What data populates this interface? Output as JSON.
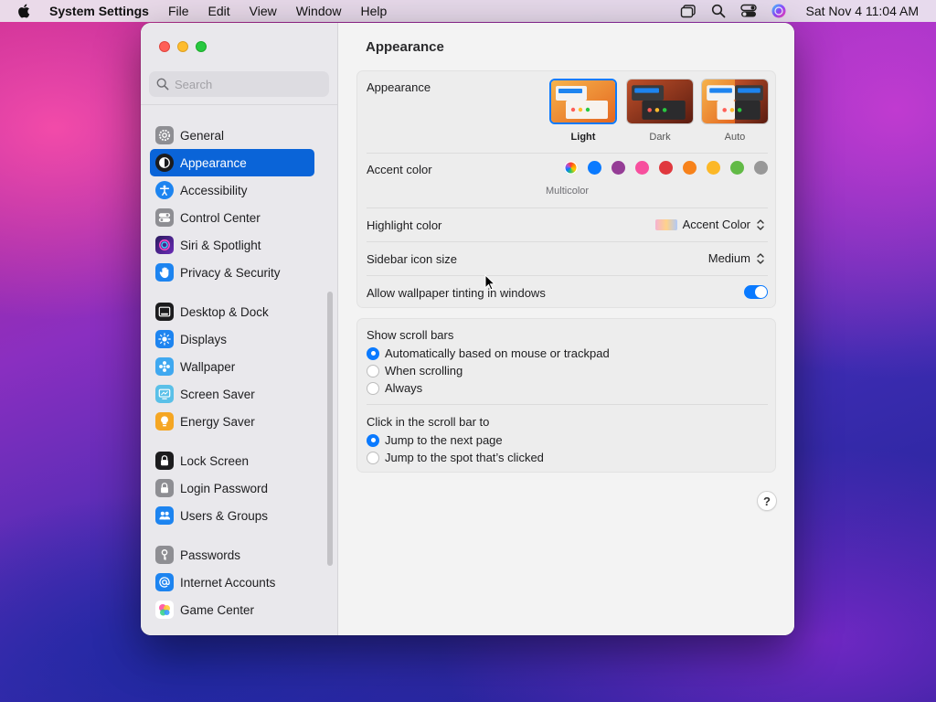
{
  "menubar": {
    "app_name": "System Settings",
    "items": [
      "File",
      "Edit",
      "View",
      "Window",
      "Help"
    ],
    "clock": "Sat Nov 4  11:04 AM"
  },
  "sidebar": {
    "search_placeholder": "Search",
    "groups": [
      [
        {
          "label": "General",
          "icon": "gear-icon",
          "color": "#8e8e93"
        },
        {
          "label": "Appearance",
          "icon": "appearance-icon",
          "color": "#1c1c1e",
          "selected": true
        },
        {
          "label": "Accessibility",
          "icon": "accessibility-icon",
          "color": "#1d84f0"
        },
        {
          "label": "Control Center",
          "icon": "control-center-icon",
          "color": "#8e8e93"
        },
        {
          "label": "Siri & Spotlight",
          "icon": "siri-icon",
          "color": "#5a2bb8"
        },
        {
          "label": "Privacy & Security",
          "icon": "hand-icon",
          "color": "#1d84f0"
        }
      ],
      [
        {
          "label": "Desktop & Dock",
          "icon": "dock-icon",
          "color": "#1c1c1e"
        },
        {
          "label": "Displays",
          "icon": "sun-icon",
          "color": "#1d84f0"
        },
        {
          "label": "Wallpaper",
          "icon": "wallpaper-icon",
          "color": "#3fa8f0"
        },
        {
          "label": "Screen Saver",
          "icon": "screen-saver-icon",
          "color": "#5ac0e8"
        },
        {
          "label": "Energy Saver",
          "icon": "bulb-icon",
          "color": "#f5a623"
        }
      ],
      [
        {
          "label": "Lock Screen",
          "icon": "lock-icon",
          "color": "#1c1c1e"
        },
        {
          "label": "Login Password",
          "icon": "padlock-icon",
          "color": "#8e8e93"
        },
        {
          "label": "Users & Groups",
          "icon": "users-icon",
          "color": "#1d84f0"
        }
      ],
      [
        {
          "label": "Passwords",
          "icon": "key-icon",
          "color": "#8e8e93"
        },
        {
          "label": "Internet Accounts",
          "icon": "at-icon",
          "color": "#1d84f0"
        },
        {
          "label": "Game Center",
          "icon": "game-center-icon",
          "color": "#ffffff"
        }
      ]
    ]
  },
  "main": {
    "title": "Appearance",
    "appearance": {
      "label": "Appearance",
      "options": [
        {
          "label": "Light",
          "selected": true
        },
        {
          "label": "Dark",
          "selected": false
        },
        {
          "label": "Auto",
          "selected": false
        }
      ]
    },
    "accent": {
      "label": "Accent color",
      "multicolor_label": "Multicolor",
      "colors": [
        "multicolor",
        "#0a7aff",
        "#953d96",
        "#f74f9e",
        "#e0383e",
        "#f7821b",
        "#fcb827",
        "#62ba46",
        "#989898"
      ]
    },
    "highlight": {
      "label": "Highlight color",
      "value": "Accent Color"
    },
    "icon_size": {
      "label": "Sidebar icon size",
      "value": "Medium"
    },
    "tinting": {
      "label": "Allow wallpaper tinting in windows",
      "on": true
    },
    "scroll_bars": {
      "label": "Show scroll bars",
      "options": [
        {
          "label": "Automatically based on mouse or trackpad",
          "selected": true
        },
        {
          "label": "When scrolling",
          "selected": false
        },
        {
          "label": "Always",
          "selected": false
        }
      ]
    },
    "click_scroll": {
      "label": "Click in the scroll bar to",
      "options": [
        {
          "label": "Jump to the next page",
          "selected": true
        },
        {
          "label": "Jump to the spot that’s clicked",
          "selected": false
        }
      ]
    },
    "help_label": "?"
  }
}
